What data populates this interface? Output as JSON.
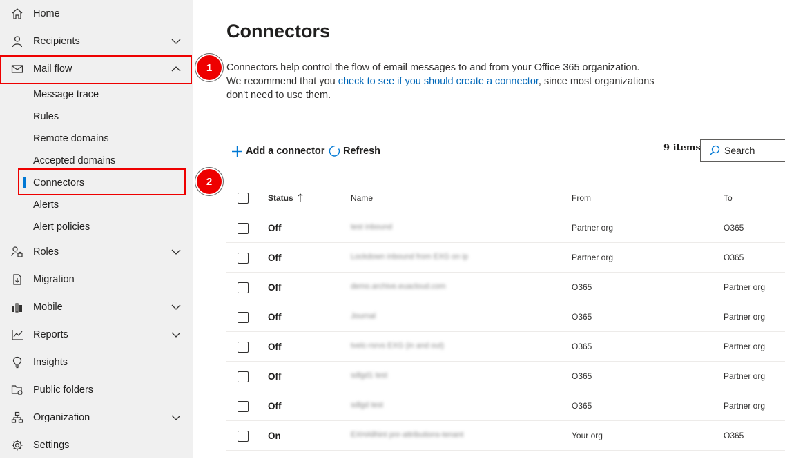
{
  "sidebar": {
    "items": [
      {
        "label": "Home",
        "icon": "home-icon",
        "expandable": false
      },
      {
        "label": "Recipients",
        "icon": "person-icon",
        "expandable": true
      },
      {
        "label": "Mail flow",
        "icon": "mail-icon",
        "expandable": true,
        "expanded": true
      },
      {
        "label": "Roles",
        "icon": "roles-icon",
        "expandable": true
      },
      {
        "label": "Migration",
        "icon": "migration-icon",
        "expandable": false
      },
      {
        "label": "Mobile",
        "icon": "mobile-icon",
        "expandable": true
      },
      {
        "label": "Reports",
        "icon": "chart-icon",
        "expandable": true
      },
      {
        "label": "Insights",
        "icon": "lightbulb-icon",
        "expandable": false
      },
      {
        "label": "Public folders",
        "icon": "folder-icon",
        "expandable": false
      },
      {
        "label": "Organization",
        "icon": "org-icon",
        "expandable": true
      },
      {
        "label": "Settings",
        "icon": "gear-icon",
        "expandable": false
      }
    ],
    "mailflow_sub": [
      "Message trace",
      "Rules",
      "Remote domains",
      "Accepted domains",
      "Connectors",
      "Alerts",
      "Alert policies"
    ],
    "selected": "Connectors"
  },
  "callouts": [
    "1",
    "2"
  ],
  "page": {
    "title": "Connectors",
    "desc_before": "Connectors help control the flow of email messages to and from your Office 365 organization. We recommend that you ",
    "desc_link": "check to see if you should create a connector",
    "desc_after": ", since most organizations don't need to use them."
  },
  "commands": {
    "add": "Add a connector",
    "refresh": "Refresh",
    "count": "9 items",
    "search": "Search"
  },
  "table": {
    "headers": {
      "status": "Status",
      "name": "Name",
      "from": "From",
      "to": "To"
    },
    "rows": [
      {
        "status": "Off",
        "name": "test inbound",
        "from": "Partner org",
        "to": "O365"
      },
      {
        "status": "Off",
        "name": "Lockdown inbound from EXG on ip",
        "from": "Partner org",
        "to": "O365"
      },
      {
        "status": "Off",
        "name": "demo.archive.euacloud.com",
        "from": "O365",
        "to": "Partner org"
      },
      {
        "status": "Off",
        "name": "Journal",
        "from": "O365",
        "to": "Partner org"
      },
      {
        "status": "Off",
        "name": "tvelc-rsrvs EXG (in and out)",
        "from": "O365",
        "to": "Partner org"
      },
      {
        "status": "Off",
        "name": "sdlgd1 test",
        "from": "O365",
        "to": "Partner org"
      },
      {
        "status": "Off",
        "name": "sdlgd test",
        "from": "O365",
        "to": "Partner org"
      },
      {
        "status": "On",
        "name": "EXHAllhint pnr-attributions-tenant",
        "from": "Your org",
        "to": "O365"
      }
    ]
  }
}
